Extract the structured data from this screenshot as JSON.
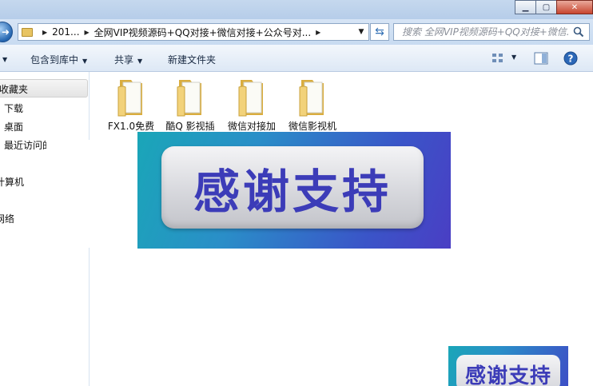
{
  "address": {
    "crumb_1": "201...",
    "crumb_2": "全网VIP视频源码+QQ对接+微信对接+公众号对...",
    "search_placeholder": "搜索 全网VIP视频源码+QQ对接+微信..."
  },
  "toolbar": {
    "organize_label": "包含到库中",
    "share_label": "共享",
    "new_folder_label": "新建文件夹"
  },
  "navpane": {
    "favorites": "收藏夹",
    "downloads": "下载",
    "desktop": "桌面",
    "recent": "最近访问的",
    "computer": "计算机",
    "network": "网络"
  },
  "folders": [
    {
      "name": "FX1.0免费"
    },
    {
      "name": "酷Q 影视插"
    },
    {
      "name": "微信对接加"
    },
    {
      "name": "微信影视机"
    }
  ],
  "banner": {
    "text": "感谢支持"
  },
  "mini_banner": {
    "text": "感谢支持"
  },
  "colors": {
    "banner_text": "#3c3cb8",
    "folder": "#e8c462"
  }
}
